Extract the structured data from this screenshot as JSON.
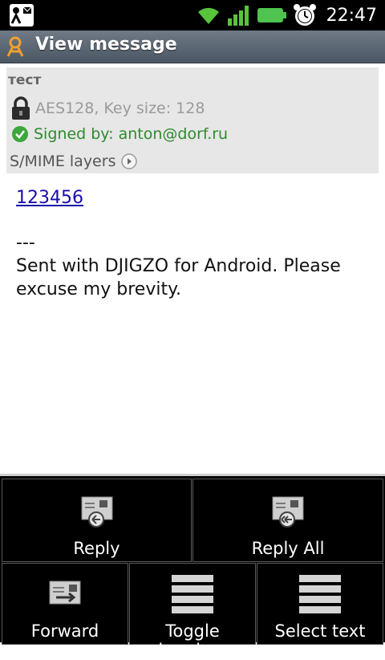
{
  "status_bar": {
    "time": "22:47",
    "icons": [
      "notification-icon",
      "wifi-icon",
      "signal-icon",
      "battery-icon",
      "alarm-icon"
    ]
  },
  "app_bar": {
    "title": "View message",
    "icon": "app-icon"
  },
  "header": {
    "subject": "тест",
    "encryption": "AES128, Key size: 128",
    "signed": "Signed by: anton@dorf.ru",
    "smime_layers": "S/MIME layers"
  },
  "message": {
    "link_text": "123456",
    "separator": "---",
    "signature": "Sent with DJIGZO for Android. Please excuse my brevity."
  },
  "menu": {
    "reply": "Reply",
    "reply_all": "Reply All",
    "forward": "Forward",
    "toggle_headers": "Toggle headers",
    "select_text": "Select text"
  },
  "colors": {
    "title_bar": "#5a6572",
    "header_bg": "#e7e7e7",
    "signed_green": "#2e8a2e",
    "link_blue": "#1a0dab",
    "battery_green": "#4ec34e",
    "wifi_green": "#58c43c"
  }
}
